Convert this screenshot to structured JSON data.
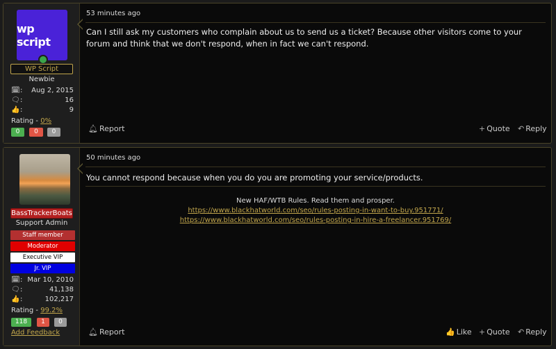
{
  "posts": [
    {
      "user": {
        "avatar_text": "wp script",
        "name": "WP Script",
        "title": "Newbie",
        "stats": [
          {
            "icon": "calendar-icon",
            "value": "Aug 2, 2015"
          },
          {
            "icon": "messages-icon",
            "value": "16"
          },
          {
            "icon": "thumbs-up-icon",
            "value": "9"
          }
        ],
        "rating_label": "Rating - ",
        "rating_pct": "0%",
        "rating_counts": [
          "0",
          "0",
          "0"
        ]
      },
      "time": "53 minutes ago",
      "message": "Can I still ask my customers who complain about us to send us a ticket? Because other visitors come to your forum and think that we don't respond, when in fact we can't respond.",
      "actions": {
        "report": "Report",
        "quote": "Quote",
        "reply": "Reply"
      }
    },
    {
      "user": {
        "name": "BassTrackerBoats",
        "title": "Support Admin",
        "badges": [
          {
            "label": "Staff member",
            "bg": "#b33030",
            "fg": "#ffffff"
          },
          {
            "label": "Moderator",
            "bg": "#e00000",
            "fg": "#ffffff"
          },
          {
            "label": "Executive VIP",
            "bg": "#ffffff",
            "fg": "#000000"
          },
          {
            "label": "Jr. VIP",
            "bg": "#0000e0",
            "fg": "#ffffff"
          }
        ],
        "stats": [
          {
            "icon": "calendar-icon",
            "value": "Mar 10, 2010"
          },
          {
            "icon": "messages-icon",
            "value": "41,138"
          },
          {
            "icon": "thumbs-up-icon",
            "value": "102,217"
          }
        ],
        "rating_label": "Rating - ",
        "rating_pct": "99.2%",
        "rating_counts": [
          "118",
          "1",
          "0"
        ],
        "add_feedback": "Add Feedback"
      },
      "time": "50 minutes ago",
      "message": "You cannot respond because when you do you are promoting your service/products.",
      "signature": {
        "line1": "New HAF/WTB Rules. Read them and prosper.",
        "link1": "https://www.blackhatworld.com/seo/rules-posting-in-want-to-buy.951771/",
        "link2": "https://www.blackhatworld.com/seo/rules-posting-in-hire-a-freelancer.951769/"
      },
      "actions": {
        "report": "Report",
        "like": "Like",
        "quote": "Quote",
        "reply": "Reply"
      }
    }
  ],
  "colors": {
    "accent": "#c2a64c",
    "background": "#0a0a0a",
    "sidebar": "#1e1e1e"
  }
}
